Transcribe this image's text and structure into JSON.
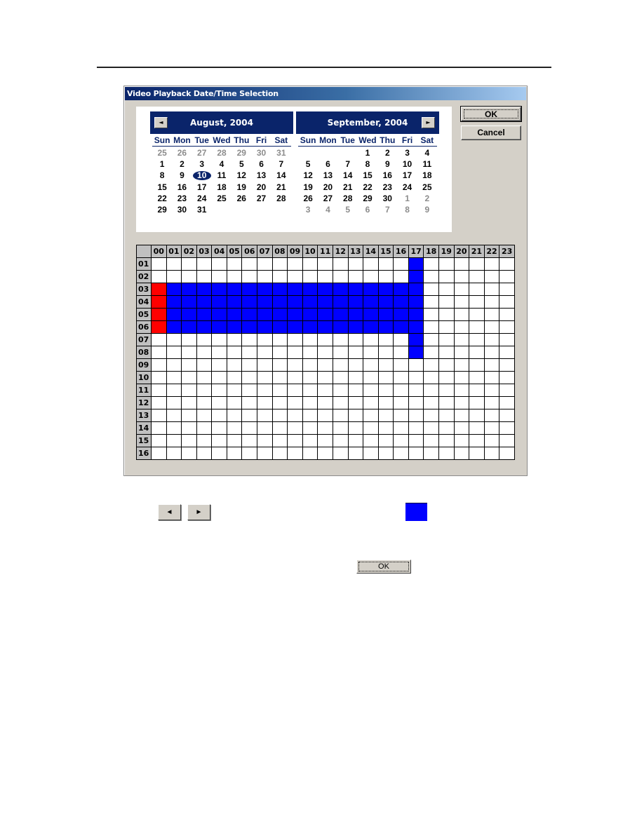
{
  "dialog": {
    "title": "Video Playback Date/Time Selection",
    "ok_label": "OK",
    "cancel_label": "Cancel"
  },
  "calendars": [
    {
      "title": "August, 2004",
      "nav": "prev",
      "nav_glyph": "◄",
      "weekdays": [
        "Sun",
        "Mon",
        "Tue",
        "Wed",
        "Thu",
        "Fri",
        "Sat"
      ],
      "weeks": [
        [
          {
            "d": "25",
            "o": true
          },
          {
            "d": "26",
            "o": true
          },
          {
            "d": "27",
            "o": true
          },
          {
            "d": "28",
            "o": true
          },
          {
            "d": "29",
            "o": true
          },
          {
            "d": "30",
            "o": true
          },
          {
            "d": "31",
            "o": true
          }
        ],
        [
          {
            "d": "1"
          },
          {
            "d": "2"
          },
          {
            "d": "3"
          },
          {
            "d": "4"
          },
          {
            "d": "5"
          },
          {
            "d": "6"
          },
          {
            "d": "7"
          }
        ],
        [
          {
            "d": "8"
          },
          {
            "d": "9"
          },
          {
            "d": "10",
            "s": true
          },
          {
            "d": "11"
          },
          {
            "d": "12"
          },
          {
            "d": "13"
          },
          {
            "d": "14"
          }
        ],
        [
          {
            "d": "15"
          },
          {
            "d": "16"
          },
          {
            "d": "17"
          },
          {
            "d": "18"
          },
          {
            "d": "19"
          },
          {
            "d": "20"
          },
          {
            "d": "21"
          }
        ],
        [
          {
            "d": "22"
          },
          {
            "d": "23"
          },
          {
            "d": "24"
          },
          {
            "d": "25"
          },
          {
            "d": "26"
          },
          {
            "d": "27"
          },
          {
            "d": "28"
          }
        ],
        [
          {
            "d": "29"
          },
          {
            "d": "30"
          },
          {
            "d": "31"
          },
          {
            "d": ""
          },
          {
            "d": ""
          },
          {
            "d": ""
          },
          {
            "d": ""
          }
        ]
      ]
    },
    {
      "title": "September, 2004",
      "nav": "next",
      "nav_glyph": "►",
      "weekdays": [
        "Sun",
        "Mon",
        "Tue",
        "Wed",
        "Thu",
        "Fri",
        "Sat"
      ],
      "weeks": [
        [
          {
            "d": ""
          },
          {
            "d": ""
          },
          {
            "d": ""
          },
          {
            "d": "1"
          },
          {
            "d": "2"
          },
          {
            "d": "3"
          },
          {
            "d": "4"
          }
        ],
        [
          {
            "d": "5"
          },
          {
            "d": "6"
          },
          {
            "d": "7"
          },
          {
            "d": "8"
          },
          {
            "d": "9"
          },
          {
            "d": "10"
          },
          {
            "d": "11"
          }
        ],
        [
          {
            "d": "12"
          },
          {
            "d": "13"
          },
          {
            "d": "14"
          },
          {
            "d": "15"
          },
          {
            "d": "16"
          },
          {
            "d": "17"
          },
          {
            "d": "18"
          }
        ],
        [
          {
            "d": "19"
          },
          {
            "d": "20"
          },
          {
            "d": "21"
          },
          {
            "d": "22"
          },
          {
            "d": "23"
          },
          {
            "d": "24"
          },
          {
            "d": "25"
          }
        ],
        [
          {
            "d": "26"
          },
          {
            "d": "27"
          },
          {
            "d": "28"
          },
          {
            "d": "29"
          },
          {
            "d": "30"
          },
          {
            "d": "1",
            "o": true
          },
          {
            "d": "2",
            "o": true
          }
        ],
        [
          {
            "d": "3",
            "o": true
          },
          {
            "d": "4",
            "o": true
          },
          {
            "d": "5",
            "o": true
          },
          {
            "d": "6",
            "o": true
          },
          {
            "d": "7",
            "o": true
          },
          {
            "d": "8",
            "o": true
          },
          {
            "d": "9",
            "o": true
          }
        ]
      ]
    }
  ],
  "schedule": {
    "hours": [
      "00",
      "01",
      "02",
      "03",
      "04",
      "05",
      "06",
      "07",
      "08",
      "09",
      "10",
      "11",
      "12",
      "13",
      "14",
      "15",
      "16",
      "17",
      "18",
      "19",
      "20",
      "21",
      "22",
      "23"
    ],
    "days": [
      "01",
      "02",
      "03",
      "04",
      "05",
      "06",
      "07",
      "08",
      "09",
      "10",
      "11",
      "12",
      "13",
      "14",
      "15",
      "16"
    ],
    "selection_colors": {
      "blue": "#0000ff",
      "red": "#ff0000"
    },
    "cells": {
      "blue": [
        {
          "day": "01",
          "hours": [
            "17"
          ]
        },
        {
          "day": "02",
          "hours": [
            "17"
          ]
        },
        {
          "day": "03",
          "hours": [
            "01",
            "02",
            "03",
            "04",
            "05",
            "06",
            "07",
            "08",
            "09",
            "10",
            "11",
            "12",
            "13",
            "14",
            "15",
            "16",
            "17"
          ]
        },
        {
          "day": "04",
          "hours": [
            "01",
            "02",
            "03",
            "04",
            "05",
            "06",
            "07",
            "08",
            "09",
            "10",
            "11",
            "12",
            "13",
            "14",
            "15",
            "16",
            "17"
          ]
        },
        {
          "day": "05",
          "hours": [
            "01",
            "02",
            "03",
            "04",
            "05",
            "06",
            "07",
            "08",
            "09",
            "10",
            "11",
            "12",
            "13",
            "14",
            "15",
            "16",
            "17"
          ]
        },
        {
          "day": "06",
          "hours": [
            "01",
            "02",
            "03",
            "04",
            "05",
            "06",
            "07",
            "08",
            "09",
            "10",
            "11",
            "12",
            "13",
            "14",
            "15",
            "16",
            "17"
          ]
        },
        {
          "day": "07",
          "hours": [
            "17"
          ]
        },
        {
          "day": "08",
          "hours": [
            "17"
          ]
        }
      ],
      "red": [
        {
          "day": "03",
          "hours": [
            "00"
          ]
        },
        {
          "day": "04",
          "hours": [
            "00"
          ]
        },
        {
          "day": "05",
          "hours": [
            "00"
          ]
        },
        {
          "day": "06",
          "hours": [
            "00"
          ]
        }
      ]
    }
  },
  "legend": {
    "prev_glyph": "◄",
    "next_glyph": "►",
    "swatch_color": "#0000ff",
    "ok_label": "OK"
  }
}
